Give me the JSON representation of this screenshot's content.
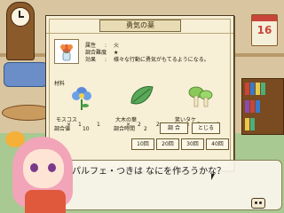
{
  "panel": {
    "title": "勇気の薬"
  },
  "item": {
    "attributes": [
      {
        "key": "属性",
        "value": "火"
      },
      {
        "key": "調合難度",
        "value": "★"
      },
      {
        "key": "効果",
        "value": "様々な行動に勇気がもてるようになる。"
      }
    ]
  },
  "materials": {
    "label": "材料",
    "items": [
      {
        "name": "モスコス",
        "have": "1",
        "need": "1"
      },
      {
        "name": "大木の葉",
        "have": "2",
        "need": "2"
      },
      {
        "name": "笑いタケ",
        "have": "3",
        "need": "4"
      }
    ]
  },
  "stats": {
    "difficulty_label": "調合値",
    "difficulty_value": "10",
    "time_label": "調合時間",
    "time_value": "2"
  },
  "buttons": {
    "mix": "調 合",
    "close": "とじる",
    "times": [
      "10回",
      "20回",
      "30回",
      "40回"
    ]
  },
  "calendar": {
    "day": "16"
  },
  "dialog": {
    "text": "パルフェ・つきは なにを作ろうかな？"
  },
  "icons": {
    "item": "potion-flower-icon",
    "mat1": "blue-flower-icon",
    "mat2": "green-leaf-icon",
    "mat3": "mushroom-icon"
  },
  "colors": {
    "panel_bg": "#f7efd6",
    "accent": "#c9453b"
  }
}
